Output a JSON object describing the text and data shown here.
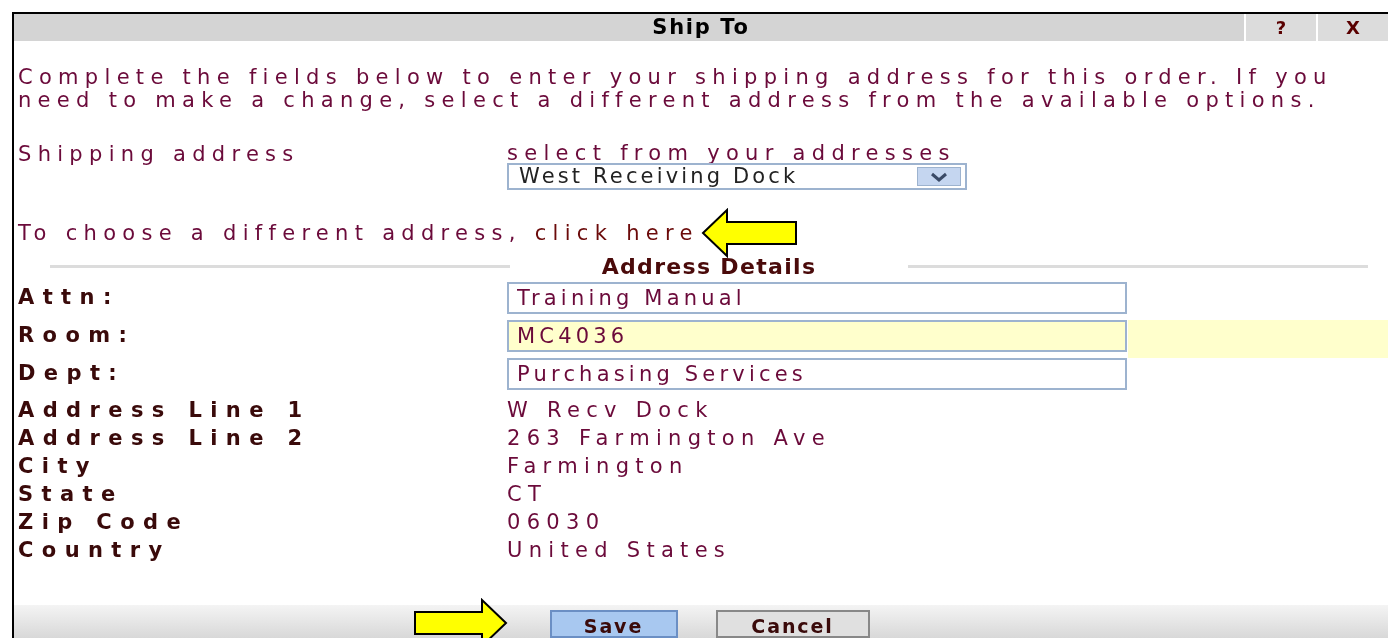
{
  "dialog": {
    "title": "Ship To",
    "title_buttons": [
      "?",
      "X"
    ]
  },
  "intro": "Complete the fields below to enter your shipping address for this order. If you need to make a change, select a different address from the available options.",
  "shipping": {
    "label": "Shipping address",
    "hint": "select from your addresses",
    "value": "West Receiving Dock"
  },
  "change_link": {
    "prefix": "To choose a different address, ",
    "link": "click here"
  },
  "section_title": "Address Details",
  "fields": [
    {
      "kind": "input",
      "label": "Attn:",
      "value": "Training Manual",
      "highlighted": false
    },
    {
      "kind": "input",
      "label": "Room:",
      "value": "MC4036",
      "highlighted": true
    },
    {
      "kind": "input",
      "label": "Dept:",
      "value": "Purchasing Services",
      "highlighted": false
    },
    {
      "kind": "static",
      "label": "Address Line 1",
      "value": "W Recv Dock"
    },
    {
      "kind": "static",
      "label": "Address Line 2",
      "value": "263 Farmington Ave"
    },
    {
      "kind": "static",
      "label": "City",
      "value": "Farmington"
    },
    {
      "kind": "static",
      "label": "State",
      "value": "CT"
    },
    {
      "kind": "static",
      "label": "Zip Code",
      "value": "06030"
    },
    {
      "kind": "static",
      "label": "Country",
      "value": "United States"
    }
  ],
  "buttons": [
    {
      "label": "Save",
      "kind": "primary"
    },
    {
      "label": "Cancel",
      "kind": "secondary"
    }
  ]
}
